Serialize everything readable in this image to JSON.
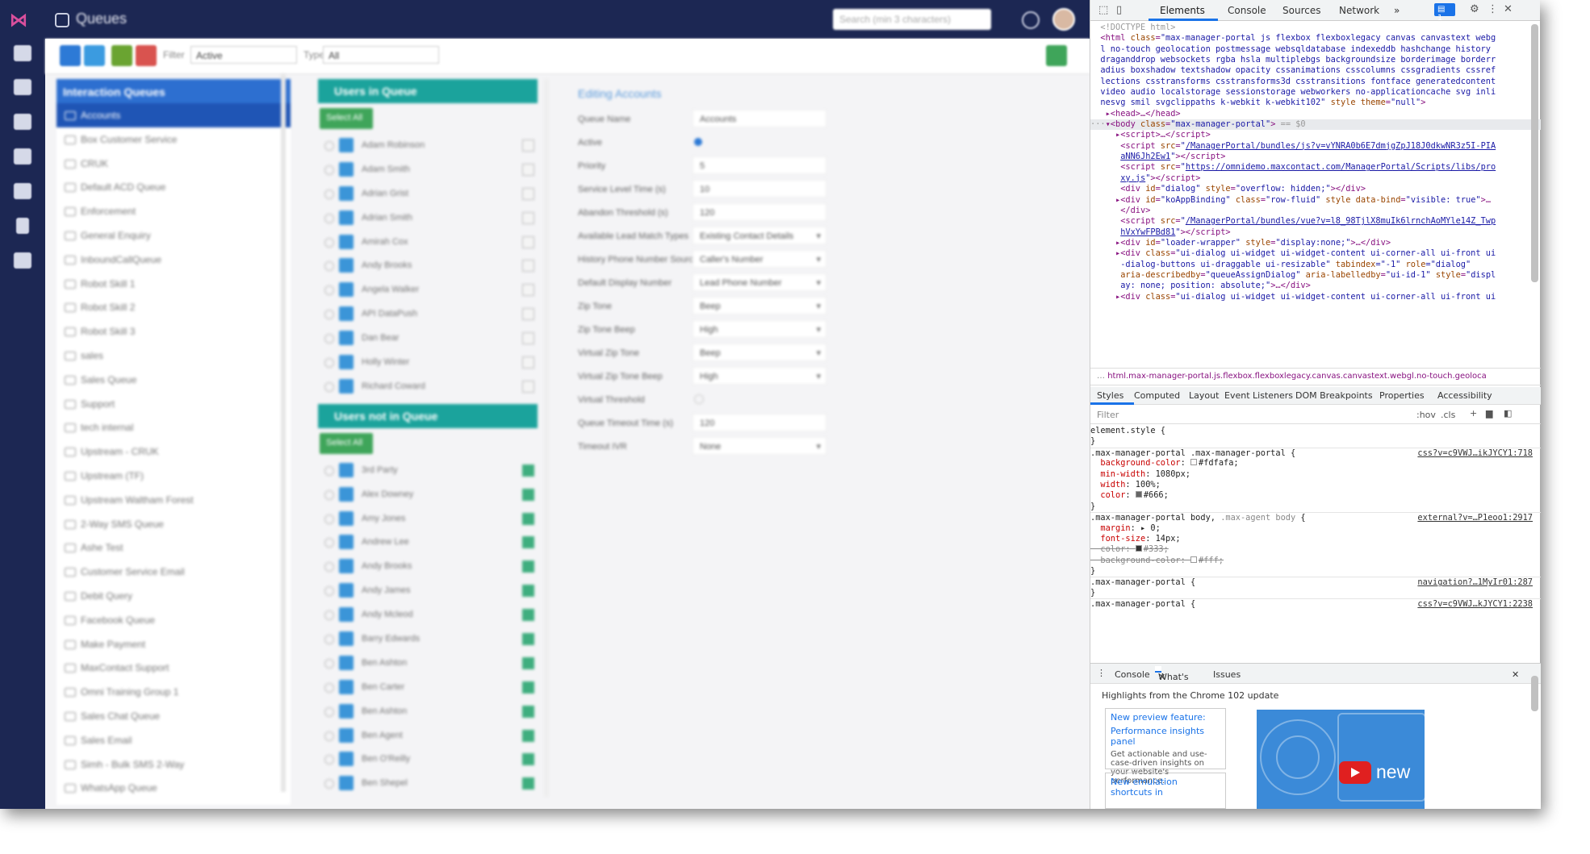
{
  "app": {
    "title": "Queues",
    "search_placeholder": "Search (min 3 characters)",
    "brand_color": "#1c2753",
    "toolbar": {
      "filter_label": "Filter",
      "filter_value": "Active",
      "type_label": "Type",
      "type_value": "All"
    },
    "nav_icons": [
      "home-icon",
      "list-icon",
      "dashboard-icon",
      "database-icon",
      "users-icon",
      "document-icon",
      "settings-icon"
    ],
    "queues_panel": {
      "title": "Interaction Queues",
      "items": [
        "Accounts",
        "Box Customer Service",
        "CRUK",
        "Default ACD Queue",
        "Enforcement",
        "General Enquiry",
        "InboundCallQueue",
        "Robot Skill 1",
        "Robot Skill 2",
        "Robot Skill 3",
        "sales",
        "Sales Queue",
        "Support",
        "tech internal",
        "Upstream - CRUK",
        "Upstream (TF)",
        "Upstream Waltham Forest",
        "2-Way SMS Queue",
        "Ashe Test",
        "Customer Service Email",
        "Debit Query",
        "Facebook Queue",
        "Make Payment",
        "MaxContact Support",
        "Omni Training Group 1",
        "Sales Chat Queue",
        "Sales Email",
        "Simh - Bulk SMS 2-Way",
        "WhatsApp Queue"
      ]
    },
    "users_in_queue": {
      "title": "Users in Queue",
      "select_all": "Select All",
      "users": [
        "Adam Robinson",
        "Adam Smith",
        "Adrian Grist",
        "Adrian Smith",
        "Amirah Cox",
        "Andy Brooks",
        "Angela Walker",
        "API DataPush",
        "Dan Bear",
        "Holly Winter",
        "Richard Coward"
      ]
    },
    "users_not_in_queue": {
      "title": "Users not in Queue",
      "select_all": "Select All",
      "users": [
        "3rd Party",
        "Alex Downey",
        "Amy Jones",
        "Andrew Lee",
        "Andy Brooks",
        "Andy James",
        "Andy Mcleod",
        "Barry Edwards",
        "Ben Ashton",
        "Ben Carter",
        "Ben Ashton",
        "Ben Agent",
        "Ben O'Reilly",
        "Ben Shepel"
      ]
    },
    "editing": {
      "title": "Editing Accounts",
      "fields": [
        {
          "label": "Queue Name",
          "value": "Accounts",
          "kind": "text"
        },
        {
          "label": "Active",
          "value": "",
          "kind": "radio"
        },
        {
          "label": "Priority",
          "value": "5",
          "kind": "text"
        },
        {
          "label": "Service Level Time (s)",
          "value": "10",
          "kind": "text"
        },
        {
          "label": "Abandon Threshold (s)",
          "value": "120",
          "kind": "text"
        },
        {
          "label": "Available Lead Match Types",
          "value": "Existing Contact Details",
          "kind": "dropdown"
        },
        {
          "label": "History Phone Number Source",
          "value": "Caller's Number",
          "kind": "dropdown"
        },
        {
          "label": "Default Display Number",
          "value": "Lead Phone Number",
          "kind": "dropdown"
        },
        {
          "label": "Zip Tone",
          "value": "Beep",
          "kind": "dropdown"
        },
        {
          "label": "Zip Tone Beep",
          "value": "High",
          "kind": "dropdown"
        },
        {
          "label": "Virtual Zip Tone",
          "value": "Beep",
          "kind": "dropdown"
        },
        {
          "label": "Virtual Zip Tone Beep",
          "value": "High",
          "kind": "dropdown"
        },
        {
          "label": "Virtual Threshold",
          "value": "",
          "kind": "check"
        },
        {
          "label": "Queue Timeout Time (s)",
          "value": "120",
          "kind": "text"
        },
        {
          "label": "Timeout IVR",
          "value": "None",
          "kind": "dropdown"
        }
      ]
    }
  },
  "devtools": {
    "tabs": [
      "Elements",
      "Console",
      "Sources",
      "Network",
      "»"
    ],
    "badge": "1",
    "breadcrumb": "html.max-manager-portal.js.flexbox.flexboxlegacy.canvas.canvastext.webgl.no-touch.geoloca",
    "subtabs": [
      "Styles",
      "Computed",
      "Layout",
      "Event Listeners",
      "DOM Breakpoints",
      "Properties",
      "Accessibility"
    ],
    "filter_placeholder": "Filter",
    "hov": ":hov",
    "cls": ".cls",
    "drawer_tabs": [
      "Console",
      "What's New",
      "Issues"
    ],
    "drawer_headline": "Highlights from the Chrome 102 update",
    "card1_link": "New preview feature:",
    "card1_link2": "Performance insights panel",
    "card1_desc": "Get actionable and use-case-driven insights on your website's performance.",
    "card2_link": "New emulation shortcuts in",
    "video_text": "new"
  }
}
